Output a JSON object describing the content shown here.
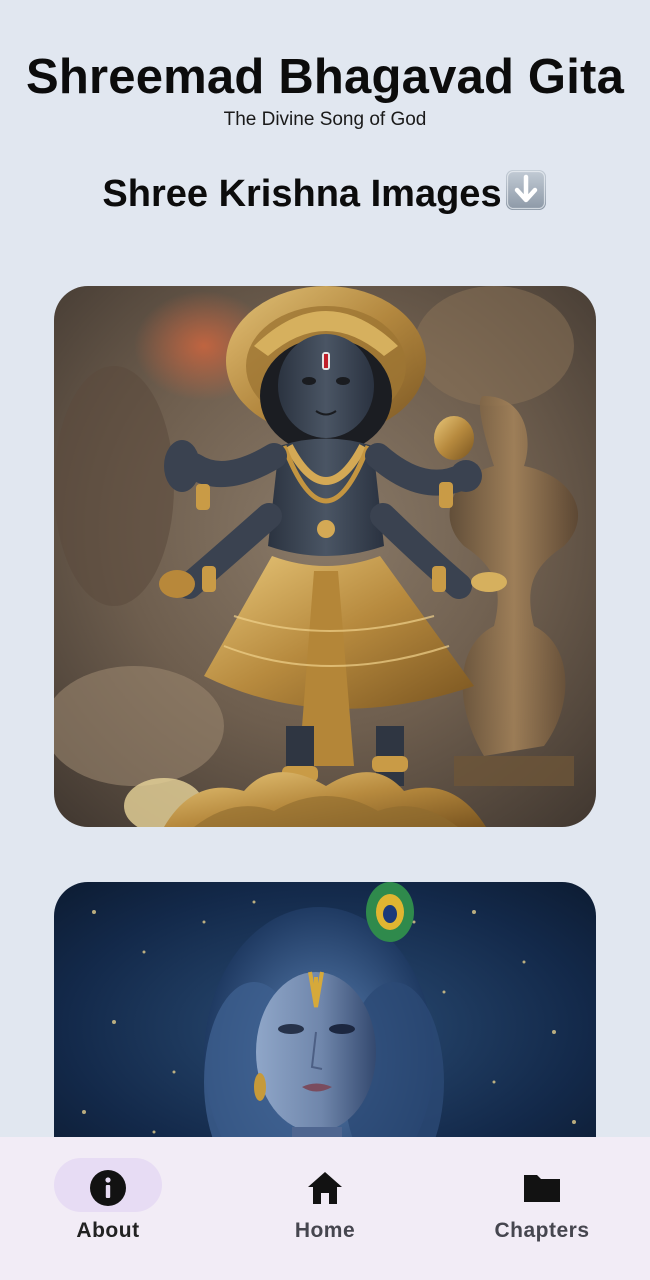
{
  "header": {
    "title": "Shreemad Bhagavad Gita",
    "subtitle": "The Divine Song of God"
  },
  "section": {
    "title": "Shree Krishna Images",
    "emoji": "down-arrow-emoji"
  },
  "images": [
    {
      "name": "krishna-image-1",
      "icon": "krishna-idol-image"
    },
    {
      "name": "krishna-image-2",
      "icon": "krishna-portrait-image"
    }
  ],
  "bottom_nav": {
    "active": "About",
    "items": [
      {
        "label": "About",
        "icon": "info-icon"
      },
      {
        "label": "Home",
        "icon": "home-icon"
      },
      {
        "label": "Chapters",
        "icon": "folder-icon"
      }
    ]
  },
  "colors": {
    "background": "#e1e7f0",
    "nav_background": "#f2ecf6",
    "active_pill": "#e7dcf4",
    "text": "#0c0c0c"
  }
}
